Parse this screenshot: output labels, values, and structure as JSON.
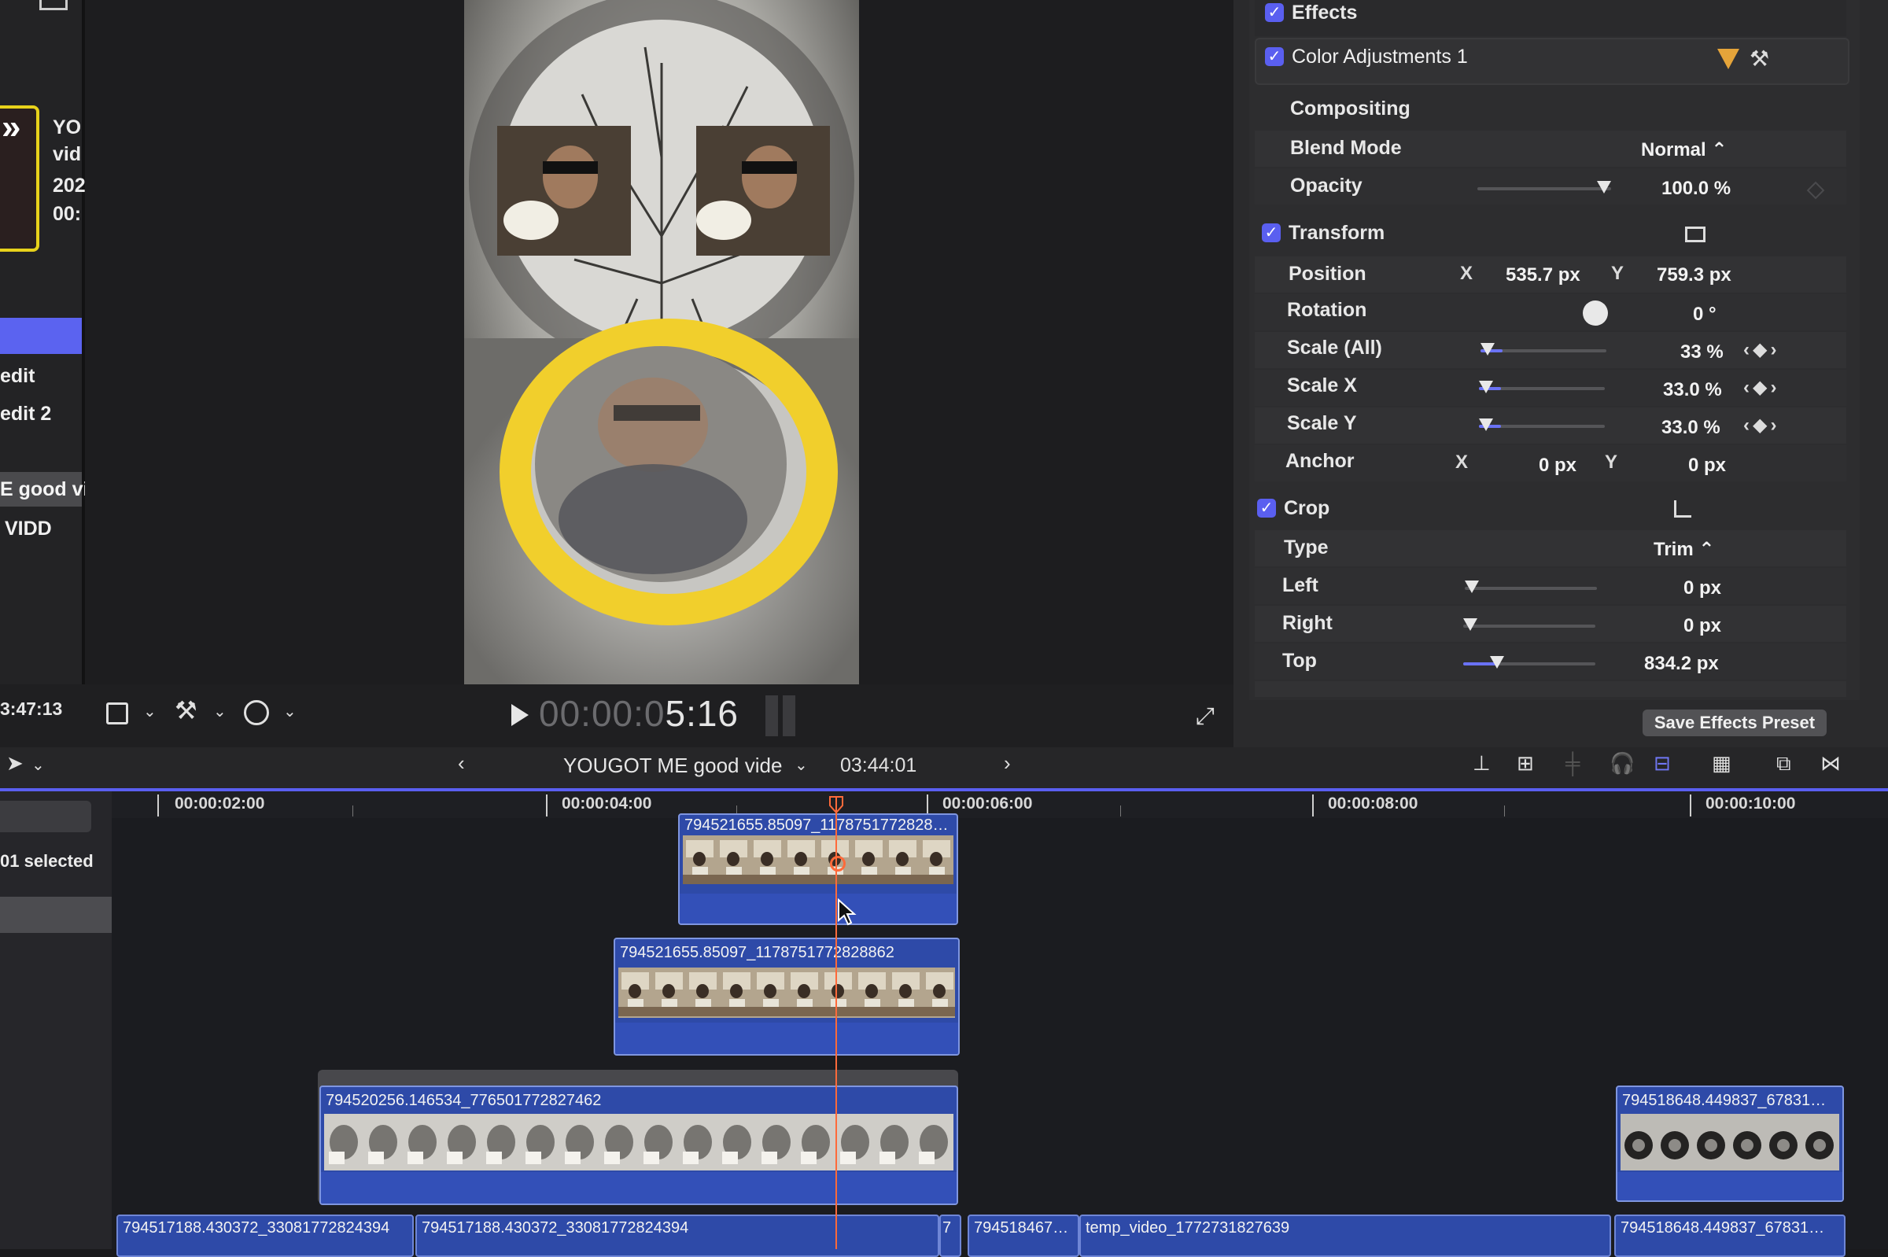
{
  "colors": {
    "accent": "#5b63f0",
    "playhead": "#ff6a3a",
    "clip_blue": "#2e4aa8",
    "selected_clip_border": "#e8d21b"
  },
  "browser": {
    "clip_meta": [
      "YO",
      "vid",
      "202",
      "00:"
    ],
    "items": [
      "edit",
      "edit 2",
      "E good vi",
      "VIDD"
    ]
  },
  "viewer": {
    "left_timecode": "3:47:13",
    "timecode_dim": "00:00:0",
    "timecode_bright": "5:16",
    "icons": [
      "crop-icon",
      "magic-wand-icon",
      "speed-icon",
      "play-icon",
      "fullscreen-icon"
    ]
  },
  "inspector": {
    "effects_label": "Effects",
    "color_adj_label": "Color Adjustments 1",
    "compositing_label": "Compositing",
    "blend_mode_label": "Blend Mode",
    "blend_mode_value": "Normal ⌃",
    "opacity_label": "Opacity",
    "opacity_value": "100.0 %",
    "transform_label": "Transform",
    "position_label": "Position",
    "axis_x": "X",
    "axis_y": "Y",
    "position_x": "535.7 px",
    "position_y": "759.3 px",
    "rotation_label": "Rotation",
    "rotation_value": "0 °",
    "scale_all_label": "Scale (All)",
    "scale_all_value": "33 %",
    "scale_x_label": "Scale X",
    "scale_x_value": "33.0 %",
    "scale_y_label": "Scale Y",
    "scale_y_value": "33.0 %",
    "anchor_label": "Anchor",
    "anchor_x": "0 px",
    "anchor_y": "0 px",
    "crop_label": "Crop",
    "type_label": "Type",
    "type_value": "Trim ⌃",
    "left_label": "Left",
    "left_value": "0 px",
    "right_label": "Right",
    "right_value": "0 px",
    "top_label": "Top",
    "top_value": "834.2 px",
    "save_preset": "Save Effects Preset",
    "opacity_level": 1.0,
    "scale_level": 0.08,
    "top_crop_level": 0.25
  },
  "timeline": {
    "project_name": "YOUGOT ME good vide",
    "project_duration": "03:44:01",
    "selected_text": "01 selected",
    "ruler": [
      "00:00:02:00",
      "00:00:04:00",
      "00:00:06:00",
      "00:00:08:00",
      "00:00:10:00"
    ],
    "clips": {
      "top": "794521655.85097_1178751772828…",
      "middle": "794521655.85097_1178751772828862",
      "bottom": "794520256.146534_776501772827462",
      "right": "794518648.449837_67831…",
      "story_1": "794517188.430372_33081772824394",
      "story_2": "794517188.430372_33081772824394",
      "story_3": "7",
      "story_4": "794518467…",
      "story_5": "temp_video_1772731827639",
      "story_6": "794518648.449837_67831…"
    }
  }
}
